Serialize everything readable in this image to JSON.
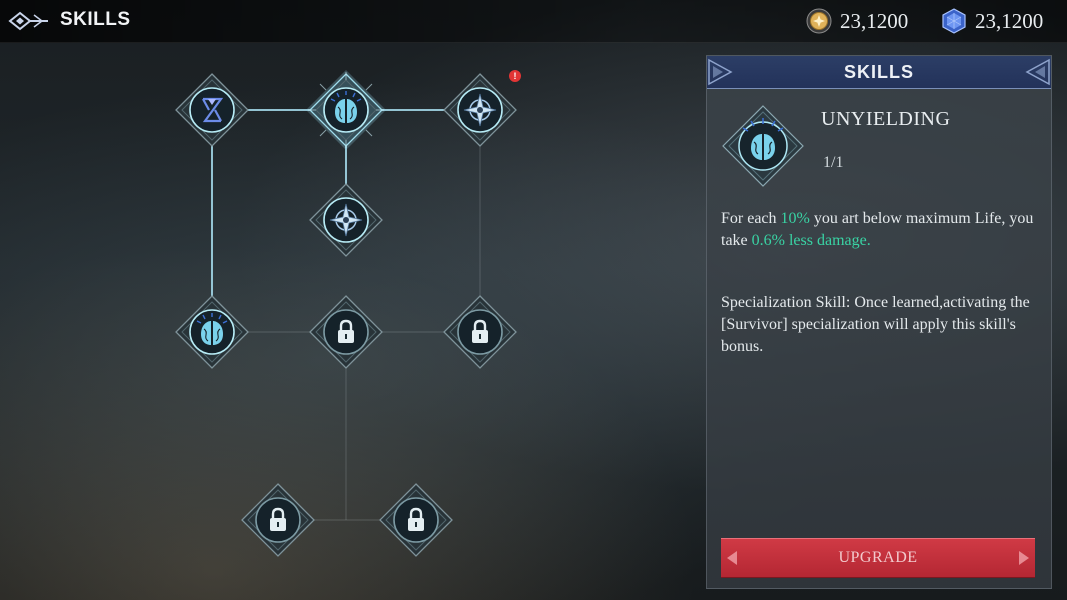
{
  "header": {
    "title": "SKILLS",
    "back_icon": "back-ornament-icon",
    "currencies": [
      {
        "icon": "gold-coin-icon",
        "value": "23,1200"
      },
      {
        "icon": "blue-gem-icon",
        "value": "23,1200"
      }
    ]
  },
  "tree": {
    "nodes": [
      {
        "id": "n1",
        "icon": "hourglass-rune-icon",
        "state": "unlocked"
      },
      {
        "id": "n2",
        "icon": "brain-skill-icon",
        "state": "selected"
      },
      {
        "id": "n3",
        "icon": "compass-star-icon",
        "state": "unlocked",
        "alert": "!"
      },
      {
        "id": "n4",
        "icon": "compass-star-icon",
        "state": "unlocked"
      },
      {
        "id": "n5",
        "icon": "brain-skill-icon",
        "state": "unlocked"
      },
      {
        "id": "n6",
        "icon": "lock-icon",
        "state": "locked"
      },
      {
        "id": "n7",
        "icon": "lock-icon",
        "state": "locked"
      },
      {
        "id": "n8",
        "icon": "lock-icon",
        "state": "locked"
      },
      {
        "id": "n9",
        "icon": "lock-icon",
        "state": "locked"
      }
    ]
  },
  "panel": {
    "header": "SKILLS",
    "skill_name": "UNYIELDING",
    "skill_icon": "brain-skill-icon",
    "level": "1/1",
    "desc1": {
      "a": "For each ",
      "b": "10%",
      "c": " you art below maximum Life, you take ",
      "d": "0.6% less damage."
    },
    "desc2": "Specialization Skill: Once learned,activating the [Survivor] specialization will apply this skill's bonus.",
    "upgrade_label": "UPGRADE"
  },
  "colors": {
    "accent_green": "#39d3a4",
    "upgrade_red": "#c8323e",
    "panel_header_blue": "#2a3c64",
    "node_glow": "#8fd6ee"
  }
}
